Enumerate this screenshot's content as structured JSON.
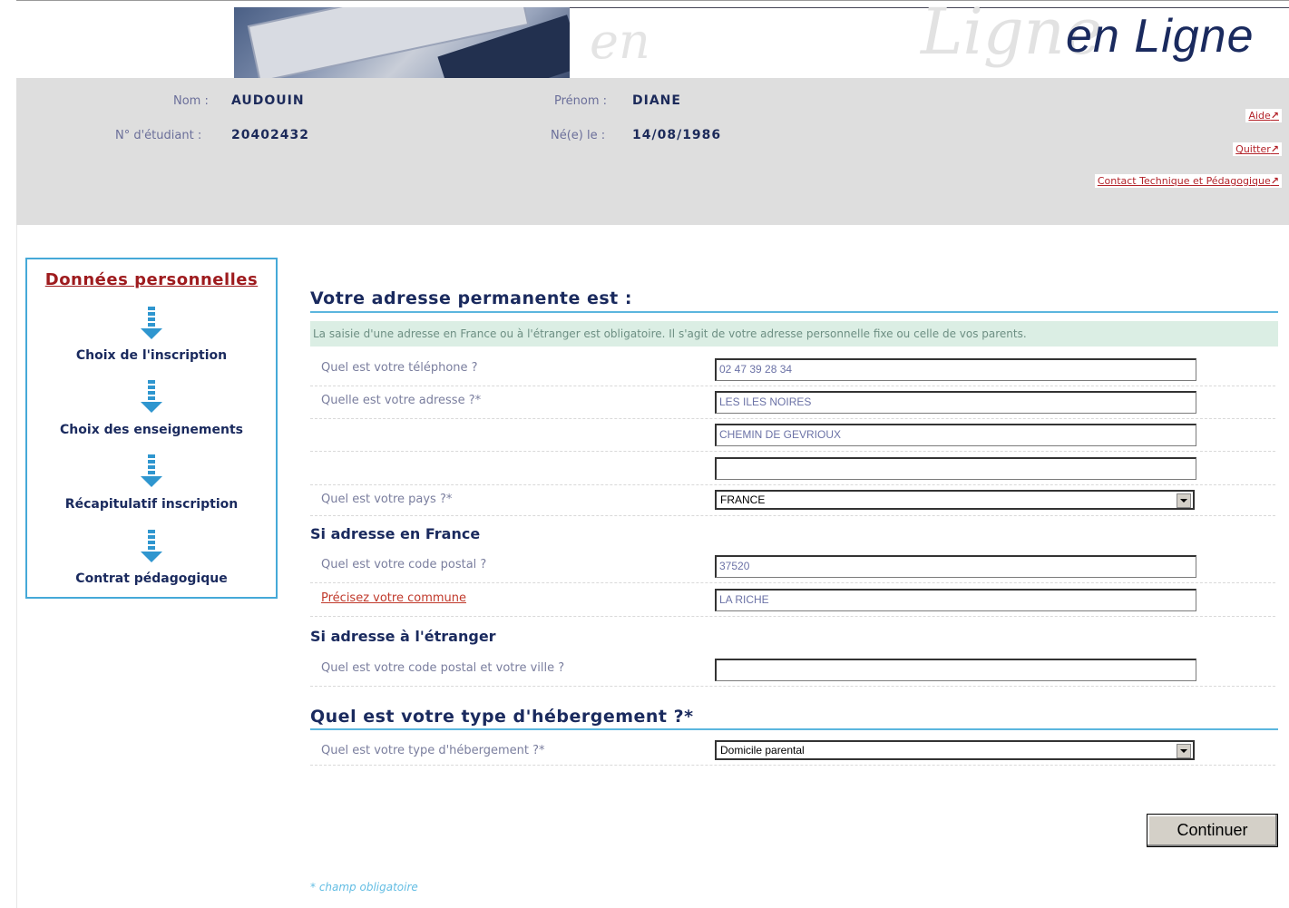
{
  "banner": {
    "logo": "en Ligne",
    "watermark_en": "en",
    "watermark_ligne": "Ligne"
  },
  "identity": {
    "nom_label": "Nom :",
    "nom_value": "AUDOUIN",
    "prenom_label": "Prénom :",
    "prenom_value": "DIANE",
    "etudiant_label": "N° d'étudiant :",
    "etudiant_value": "20402432",
    "ne_label": "Né(e) le :",
    "ne_value": "14/08/1986"
  },
  "links": {
    "aide": "Aide",
    "quitter": "Quitter",
    "contact": "Contact Technique et Pédagogique",
    "arrow": "↗"
  },
  "sidebar": {
    "current": "Données personnelles",
    "steps": [
      "Choix de l'inscription",
      "Choix des enseignements",
      "Récapitulatif inscription",
      "Contrat pédagogique"
    ]
  },
  "form": {
    "title": "Votre adresse permanente est :",
    "notice": "La saisie d'une adresse en France ou à l'étranger est obligatoire. Il s'agit de votre adresse personnelle fixe ou celle de vos parents.",
    "telephone_label": "Quel est votre téléphone ?",
    "telephone_value": "02 47 39 28 34",
    "adresse_label": "Quelle est votre adresse ?*",
    "adresse_line1": "LES ILES NOIRES",
    "adresse_line2": "CHEMIN DE GEVRIOUX",
    "adresse_line3": "",
    "pays_label": "Quel est votre pays ?*",
    "pays_value": "FRANCE",
    "france_heading": "Si adresse en France",
    "cp_label": "Quel est votre code postal ?",
    "cp_value": "37520",
    "commune_label": "Précisez votre commune",
    "commune_value": "LA RICHE",
    "etranger_heading": "Si adresse à l'étranger",
    "etranger_label": "Quel est votre code postal et votre ville ?",
    "etranger_value": "",
    "hebergement_title": "Quel est votre type d'hébergement ?*",
    "hebergement_label": "Quel est votre type d'hébergement ?*",
    "hebergement_value": "Domicile parental",
    "continue_label": "Continuer",
    "footnote": "* champ obligatoire"
  },
  "colors": {
    "navy": "#1a2a5e",
    "accent_blue": "#45a9d8",
    "link_red": "#b3232a",
    "notice_bg": "#dbeee4"
  }
}
